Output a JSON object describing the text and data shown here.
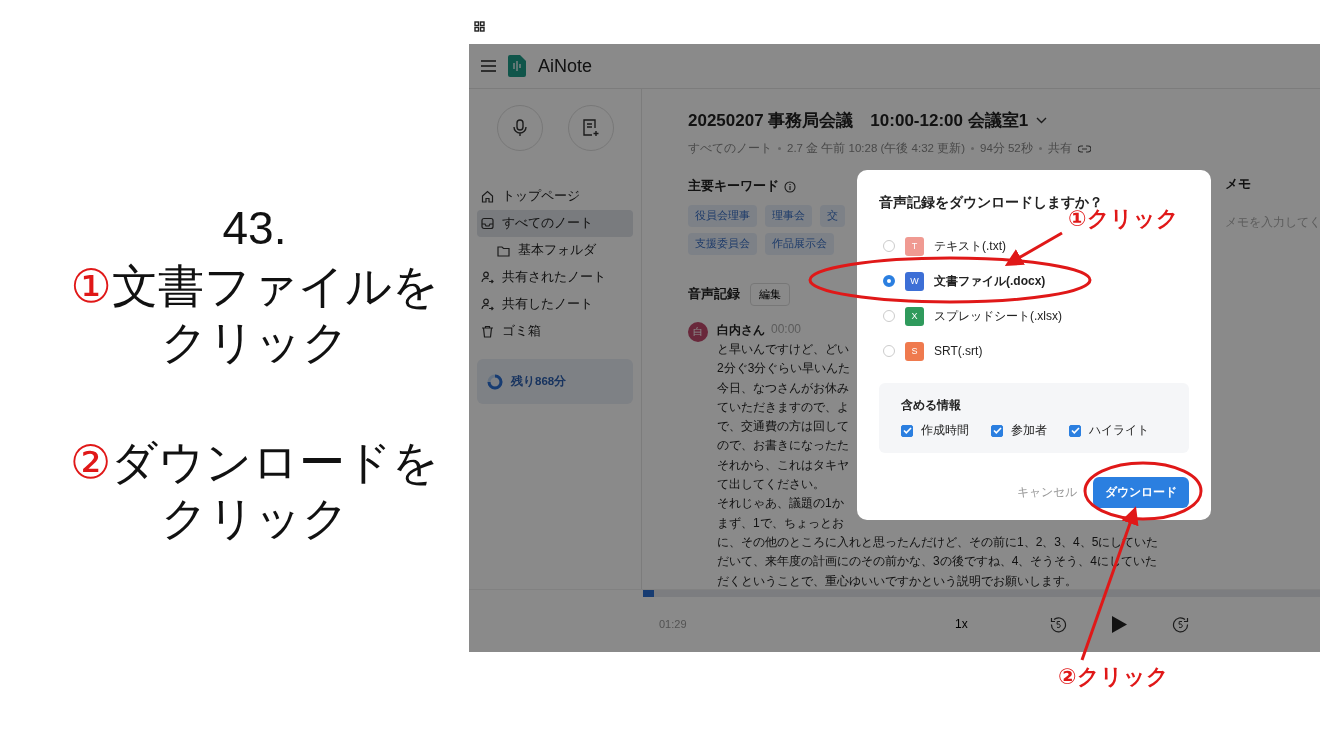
{
  "slide": {
    "number": "43.",
    "steps": [
      {
        "marker": "①",
        "lines": [
          "文書ファイルを",
          "クリック"
        ]
      },
      {
        "marker": "②",
        "lines": [
          "ダウンロードを",
          "クリック"
        ]
      }
    ]
  },
  "app": {
    "brand": "AiNote",
    "sidebar": {
      "items": [
        {
          "label": "トップページ",
          "selected": false
        },
        {
          "label": "すべてのノート",
          "selected": true,
          "children": [
            {
              "label": "基本フォルダ",
              "selected": false
            }
          ]
        },
        {
          "label": "共有されたノート",
          "selected": false
        },
        {
          "label": "共有したノート",
          "selected": false
        },
        {
          "label": "ゴミ箱",
          "selected": false
        }
      ],
      "remaining": "残り868分"
    },
    "note": {
      "title": "20250207 事務局会議　10:00-12:00 会議室1",
      "meta": [
        "すべてのノート",
        "2.7 金 午前 10:28 (午後 4:32 更新)",
        "94分 52秒",
        "共有"
      ],
      "keywords_heading": "主要キーワード",
      "keywords": [
        [
          "役員会理事",
          "理事会",
          "交"
        ],
        [
          "支援委員会",
          "作品展示会"
        ]
      ]
    },
    "memo": {
      "heading": "メモ",
      "placeholder": "メモを入力してく"
    },
    "transcript": {
      "heading": "音声記録",
      "edit_button": "編集",
      "avatar": "白",
      "speaker": "白内さん",
      "time": "00:00",
      "lines": [
        "と早いんですけど、どい",
        "2分ぐ3分ぐらい早いんた",
        "今日、なつさんがお休み",
        "ていただきますので、よ",
        "で、交通費の方は回して",
        "ので、お書きになったた",
        "それから、これはタキヤ",
        "て出してください。",
        "それじゃあ、議題の1か",
        "まず、1で、ちょっとお",
        "に、その他のところに入れと思ったんだけど、その前に1、2、3、4、5にしていた",
        "だいて、来年度の計画にのその前かな、3の後ですね、4、そうそう、4にしていた",
        "だくということで、重心ゆいいですかという説明でお願いします。"
      ]
    },
    "player": {
      "level": 0.016,
      "elapsed": "01:29",
      "speed": "1x"
    }
  },
  "dialog": {
    "title": "音声記録をダウンロードしますか？",
    "options": [
      {
        "letter": "T",
        "color": "#f09a92",
        "label": "テキスト(.txt)",
        "selected": false
      },
      {
        "letter": "W",
        "color": "#3d6fd6",
        "label": "文書ファイル(.docx)",
        "selected": true
      },
      {
        "letter": "X",
        "color": "#2f9a5c",
        "label": "スプレッドシート(.xlsx)",
        "selected": false
      },
      {
        "letter": "S",
        "color": "#ef7a4e",
        "label": "SRT(.srt)",
        "selected": false
      }
    ],
    "include_heading": "含める情報",
    "include": [
      {
        "label": "作成時間",
        "checked": true
      },
      {
        "label": "参加者",
        "checked": true
      },
      {
        "label": "ハイライト",
        "checked": true
      }
    ],
    "cancel": "キャンセル",
    "confirm": "ダウンロード"
  },
  "annotations": [
    {
      "label": "①クリック"
    },
    {
      "label": "②クリック"
    }
  ]
}
